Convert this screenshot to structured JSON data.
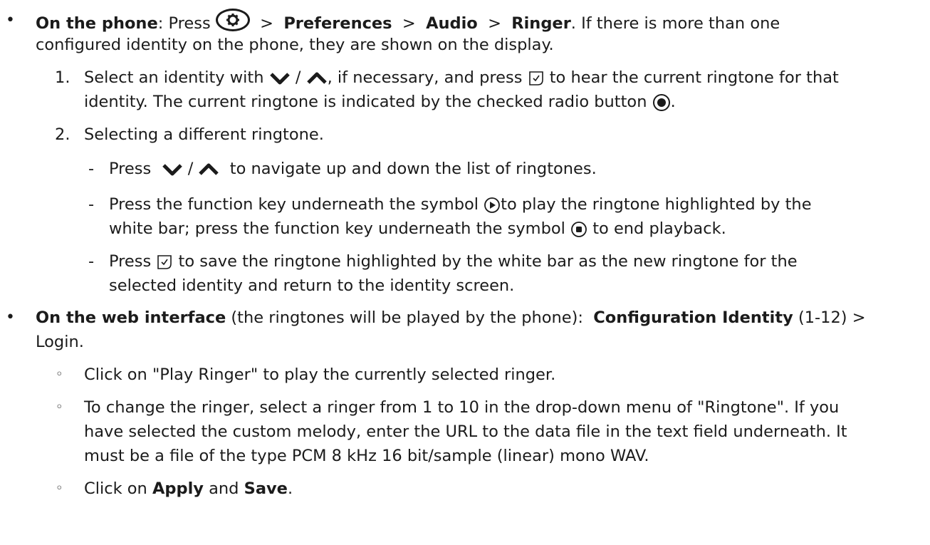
{
  "phone": {
    "bullet_label": "On the phone",
    "press_prefix": ": Press",
    "sep": ">",
    "menu_preferences": "Preferences",
    "menu_audio": "Audio",
    "menu_ringer": "Ringer",
    "line1_tail": ". If there is more than one",
    "line2": "configured identity on the phone, they are shown on the display."
  },
  "steps": {
    "step1_number": "1.",
    "step1_a": "Select an identity with",
    "step1_slash": "/",
    "step1_b": ", if necessary, and press",
    "step1_c": "to hear the current ringtone for that",
    "step1_line2": "identity. The current ringtone is indicated by the checked radio button",
    "step1_end": ".",
    "step2_number": "2.",
    "step2_text": "Selecting a different ringtone."
  },
  "substeps": {
    "dash": "-",
    "nav_press": "Press",
    "nav_slash": "/",
    "nav_tail": "to navigate up and down the list of ringtones.",
    "play_a": "Press the function key underneath the symbol",
    "play_b": "to play the ringtone highlighted by the",
    "play_line2_a": "white bar; press the function key underneath the symbol",
    "play_line2_b": "to end playback.",
    "save_press": "Press",
    "save_a": "to save the ringtone highlighted by the white bar as the new ringtone for the",
    "save_line2": "selected identity and return to the identity screen."
  },
  "web": {
    "bullet_label": "On the web interface",
    "intro": "(the ringtones will be played by the phone):",
    "config": "Configuration Identity",
    "range": "(1-12) >",
    "login": "Login.",
    "item1": "Click on \"Play Ringer\" to play the currently selected ringer.",
    "item2_line1": "To change the ringer, select a ringer from 1 to 10 in the drop-down menu of \"Ringtone\". If you",
    "item2_line2": "have selected the custom melody, enter the URL to the data file in the text field underneath. It",
    "item2_line3": "must be a file of the type PCM 8 kHz 16 bit/sample (linear) mono WAV.",
    "item3_a": "Click on",
    "item3_apply": "Apply",
    "item3_and": "and",
    "item3_save": "Save",
    "item3_end": "."
  },
  "markers": {
    "bullet": "•",
    "circle": "◦"
  },
  "icons": {
    "settings_key": "settings-key-icon",
    "down": "chevron-down-icon",
    "up": "chevron-up-icon",
    "ok": "ok-check-icon",
    "radio": "radio-checked-icon",
    "play": "play-icon",
    "stop": "stop-icon"
  }
}
